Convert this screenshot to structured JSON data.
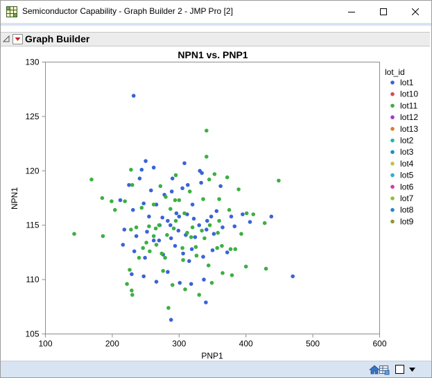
{
  "window": {
    "title": "Semiconductor Capability - Graph Builder 2 - JMP Pro [2]"
  },
  "outline": {
    "title": "Graph Builder"
  },
  "colors": {
    "lot1": "#3a64d6",
    "lot11": "#3cb043",
    "lot10": "#d64a5c",
    "lot12": "#a238d0",
    "lot13": "#e07a2a",
    "lot2": "#27b5a6",
    "lot3": "#1c8ec9",
    "lot4": "#c8c040",
    "lot5": "#27b5c6",
    "lot6": "#d63a9a",
    "lot7": "#8cbf3a",
    "lot8": "#2a86c6",
    "lot9": "#8c9a2a"
  },
  "chart_data": {
    "type": "scatter",
    "title": "NPN1 vs. PNP1",
    "xlabel": "PNP1",
    "ylabel": "NPN1",
    "xlim": [
      100,
      600
    ],
    "ylim": [
      105,
      130
    ],
    "xticks": [
      "100",
      "200",
      "300",
      "400",
      "500",
      "600"
    ],
    "yticks": [
      "105",
      "110",
      "115",
      "120",
      "125",
      "130"
    ],
    "grid": false,
    "legend_title": "lot_id",
    "legend_position": "right",
    "legend": [
      "lot1",
      "lot10",
      "lot11",
      "lot12",
      "lot13",
      "lot2",
      "lot3",
      "lot4",
      "lot5",
      "lot6",
      "lot7",
      "lot8",
      "lot9"
    ],
    "series": [
      {
        "name": "lot1",
        "color": "#3a64d6",
        "points": [
          [
            232,
            126.9
          ],
          [
            244,
            120.1
          ],
          [
            250,
            120.9
          ],
          [
            262,
            120.3
          ],
          [
            308,
            120.7
          ],
          [
            334,
            119.8
          ],
          [
            331,
            120.0
          ],
          [
            212,
            117.3
          ],
          [
            247,
            117.0
          ],
          [
            278,
            117.8
          ],
          [
            289,
            118.1
          ],
          [
            305,
            118.4
          ],
          [
            313,
            118.7
          ],
          [
            333,
            118.9
          ],
          [
            362,
            118.6
          ],
          [
            231,
            116.4
          ],
          [
            255,
            115.8
          ],
          [
            266,
            116.9
          ],
          [
            283,
            115.4
          ],
          [
            296,
            116.1
          ],
          [
            312,
            116.0
          ],
          [
            322,
            115.6
          ],
          [
            342,
            115.4
          ],
          [
            356,
            116.3
          ],
          [
            378,
            115.8
          ],
          [
            395,
            116.0
          ],
          [
            218,
            114.6
          ],
          [
            236,
            114.0
          ],
          [
            252,
            114.4
          ],
          [
            271,
            115.0
          ],
          [
            288,
            113.8
          ],
          [
            299,
            114.5
          ],
          [
            310,
            114.1
          ],
          [
            324,
            113.9
          ],
          [
            341,
            114.6
          ],
          [
            352,
            114.2
          ],
          [
            365,
            114.8
          ],
          [
            383,
            114.9
          ],
          [
            216,
            113.2
          ],
          [
            233,
            112.6
          ],
          [
            249,
            112.0
          ],
          [
            262,
            113.6
          ],
          [
            276,
            112.3
          ],
          [
            294,
            113.1
          ],
          [
            306,
            112.4
          ],
          [
            319,
            112.8
          ],
          [
            336,
            112.1
          ],
          [
            350,
            112.7
          ],
          [
            372,
            112.5
          ],
          [
            229,
            110.5
          ],
          [
            247,
            110.3
          ],
          [
            283,
            110.7
          ],
          [
            301,
            109.7
          ],
          [
            318,
            109.6
          ],
          [
            337,
            110.0
          ],
          [
            288,
            106.3
          ],
          [
            340,
            107.9
          ],
          [
            470,
            110.3
          ],
          [
            438,
            115.8
          ],
          [
            406,
            115.3
          ],
          [
            320,
            116.9
          ],
          [
            241,
            119.3
          ],
          [
            290,
            119.3
          ],
          [
            300,
            115.8
          ],
          [
            270,
            113.6
          ],
          [
            225,
            118.7
          ],
          [
            315,
            111.7
          ],
          [
            266,
            109.8
          ],
          [
            348,
            115.8
          ],
          [
            275,
            115.7
          ],
          [
            330,
            115.0
          ],
          [
            287,
            115.0
          ],
          [
            258,
            118.2
          ]
        ]
      },
      {
        "name": "lot11",
        "color": "#3cb043",
        "points": [
          [
            143,
            114.2
          ],
          [
            169,
            119.2
          ],
          [
            185,
            117.5
          ],
          [
            199,
            117.2
          ],
          [
            204,
            116.4
          ],
          [
            219,
            117.2
          ],
          [
            228,
            120.1
          ],
          [
            230,
            118.7
          ],
          [
            186,
            114.0
          ],
          [
            255,
            114.9
          ],
          [
            265,
            114.7
          ],
          [
            272,
            118.6
          ],
          [
            280,
            117.6
          ],
          [
            294,
            117.3
          ],
          [
            341,
            123.7
          ],
          [
            341,
            121.3
          ],
          [
            345,
            119.2
          ],
          [
            360,
            117.4
          ],
          [
            372,
            119.4
          ],
          [
            389,
            118.3
          ],
          [
            449,
            119.1
          ],
          [
            393,
            114.2
          ],
          [
            411,
            116.0
          ],
          [
            428,
            115.2
          ],
          [
            430,
            111.0
          ],
          [
            400,
            111.2
          ],
          [
            377,
            112.8
          ],
          [
            379,
            110.4
          ],
          [
            364,
            113.1
          ],
          [
            338,
            113.8
          ],
          [
            326,
            112.2
          ],
          [
            320,
            114.8
          ],
          [
            305,
            112.9
          ],
          [
            292,
            114.7
          ],
          [
            279,
            112.0
          ],
          [
            262,
            114.0
          ],
          [
            246,
            112.9
          ],
          [
            236,
            114.8
          ],
          [
            229,
            109.0
          ],
          [
            226,
            110.9
          ],
          [
            222,
            109.6
          ],
          [
            230,
            108.6
          ],
          [
            284,
            107.4
          ],
          [
            309,
            109.1
          ],
          [
            330,
            108.6
          ],
          [
            349,
            109.7
          ],
          [
            365,
            110.6
          ],
          [
            344,
            111.3
          ],
          [
            306,
            111.8
          ],
          [
            295,
            115.4
          ],
          [
            276,
            110.8
          ],
          [
            256,
            112.6
          ],
          [
            312,
            114.3
          ],
          [
            357,
            112.9
          ],
          [
            325,
            113.0
          ],
          [
            353,
            119.7
          ],
          [
            300,
            117.3
          ],
          [
            282,
            114.1
          ],
          [
            266,
            113.2
          ],
          [
            240,
            112.0
          ],
          [
            334,
            114.5
          ],
          [
            346,
            115.0
          ],
          [
            384,
            112.8
          ],
          [
            308,
            116.1
          ],
          [
            262,
            116.9
          ],
          [
            274,
            112.4
          ],
          [
            290,
            109.5
          ],
          [
            316,
            118.1
          ],
          [
            295,
            119.6
          ],
          [
            336,
            117.4
          ],
          [
            375,
            116.4
          ],
          [
            360,
            115.4
          ],
          [
            318,
            113.9
          ],
          [
            244,
            116.6
          ],
          [
            228,
            114.6
          ],
          [
            251,
            113.4
          ],
          [
            401,
            116.1
          ],
          [
            358,
            114.3
          ],
          [
            270,
            115.0
          ],
          [
            287,
            116.5
          ]
        ]
      }
    ]
  }
}
